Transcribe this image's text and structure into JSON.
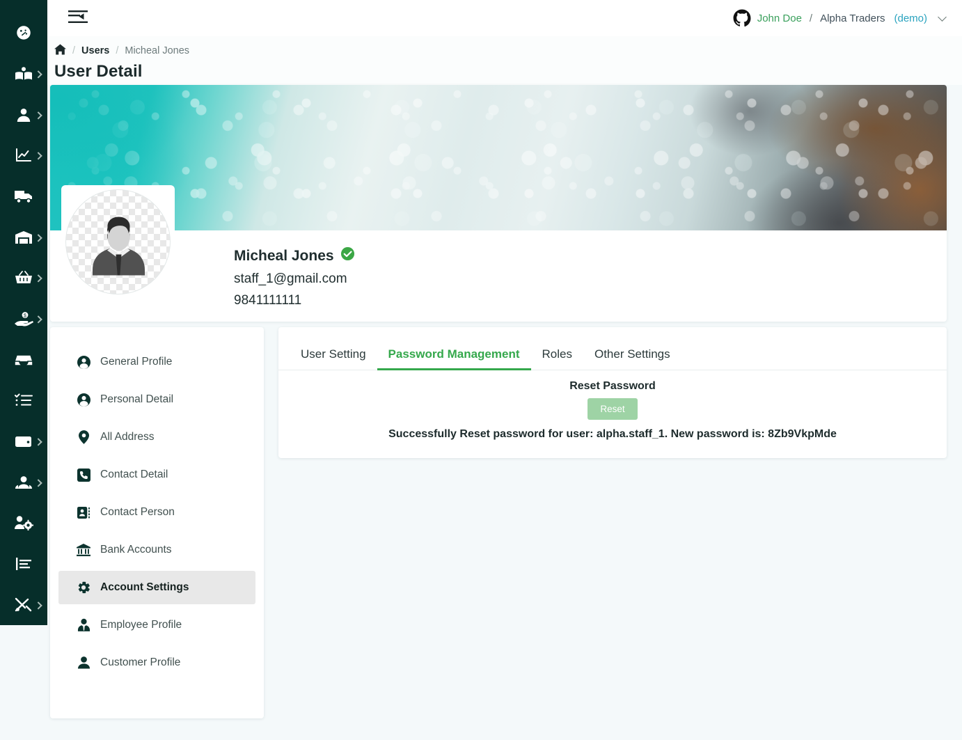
{
  "topbar": {
    "menu_toggle_icon": "menu-fold-icon",
    "account_icon": "github-mark-icon",
    "user_name": "John Doe",
    "separator": "/",
    "org_name": "Alpha Traders",
    "env_label": "(demo)"
  },
  "breadcrumb": {
    "home_icon": "home-icon",
    "sep1": "/",
    "users": "Users",
    "sep2": "/",
    "current": "Micheal Jones"
  },
  "page_title": "User Detail",
  "profile": {
    "name": "Micheal Jones",
    "verified_icon": "verified-check-icon",
    "email": "staff_1@gmail.com",
    "phone": "9841111111",
    "avatar_icon": "default-user-avatar",
    "cover_icon": "ocean-shore-cover-photo"
  },
  "left_menu": {
    "items": [
      {
        "label": "General Profile",
        "icon": "user-circle-icon",
        "active": false
      },
      {
        "label": "Personal Detail",
        "icon": "user-circle-icon",
        "active": false
      },
      {
        "label": "All Address",
        "icon": "map-pin-icon",
        "active": false
      },
      {
        "label": "Contact Detail",
        "icon": "phone-square-icon",
        "active": false
      },
      {
        "label": "Contact Person",
        "icon": "id-card-icon",
        "active": false
      },
      {
        "label": "Bank Accounts",
        "icon": "bank-icon",
        "active": false
      },
      {
        "label": "Account Settings",
        "icon": "gear-icon",
        "active": true
      },
      {
        "label": "Employee Profile",
        "icon": "employee-tie-icon",
        "active": false
      },
      {
        "label": "Customer Profile",
        "icon": "user-solid-icon",
        "active": false
      }
    ]
  },
  "tabs": [
    {
      "label": "User Setting",
      "active": false
    },
    {
      "label": "Password Management",
      "active": true
    },
    {
      "label": "Roles",
      "active": false
    },
    {
      "label": "Other Settings",
      "active": false
    }
  ],
  "panel": {
    "heading": "Reset Password",
    "reset_button": "Reset",
    "message": "Successfully Reset password for user: alpha.staff_1. New password is: 8Zb9VkpMde"
  },
  "rail": {
    "items": [
      {
        "icon": "dashboard-gauge-icon",
        "caret": false
      },
      {
        "icon": "book-reader-icon",
        "caret": true
      },
      {
        "icon": "user-icon",
        "caret": true
      },
      {
        "icon": "chart-line-icon",
        "caret": true
      },
      {
        "icon": "truck-icon",
        "caret": false
      },
      {
        "icon": "warehouse-icon",
        "caret": true
      },
      {
        "icon": "shopping-basket-icon",
        "caret": true
      },
      {
        "icon": "hand-money-icon",
        "caret": true
      },
      {
        "icon": "inbox-icon",
        "caret": false
      },
      {
        "icon": "tasks-list-icon",
        "caret": false
      },
      {
        "icon": "wallet-icon",
        "caret": true
      },
      {
        "icon": "users-group-icon",
        "caret": true
      },
      {
        "icon": "user-cog-icon",
        "caret": false
      },
      {
        "icon": "bar-chart-icon",
        "caret": false
      },
      {
        "icon": "tools-icon",
        "caret": true
      }
    ]
  },
  "colors": {
    "sidebar_bg": "#062e2a",
    "accent_green": "#35a84c",
    "brand_green": "#3aa05c",
    "demo_blue": "#2aa3bf",
    "page_bg": "#f4f9fa",
    "active_menu_bg": "#e8e8e8",
    "reset_button_bg": "#9ed3a5"
  }
}
